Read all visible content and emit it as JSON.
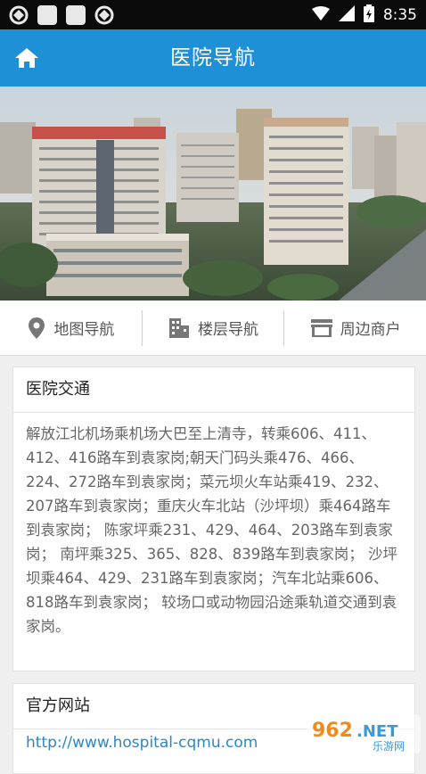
{
  "status_bar": {
    "time": "8:35"
  },
  "header": {
    "title": "医院导航"
  },
  "nav": {
    "items": [
      {
        "label": "地图导航",
        "icon": "map-pin-icon"
      },
      {
        "label": "楼层导航",
        "icon": "building-icon"
      },
      {
        "label": "周边商户",
        "icon": "storefront-icon"
      }
    ]
  },
  "traffic": {
    "title": "医院交通",
    "body": "解放江北机场乘机场大巴至上清寺，转乘606、411、412、416路车到袁家岗;朝天门码头乘476、466、224、272路车到袁家岗；菜元坝火车站乘419、232、207路车到袁家岗；重庆火车北站（沙坪坝）乘464路车到袁家岗； 陈家坪乘231、429、464、203路车到袁家岗； 南坪乘325、365、828、839路车到袁家岗； 沙坪坝乘464、429、231路车到袁家岗；汽车北站乘606、818路车到袁家岗； 较场口或动物园沿途乘轨道交通到袁家岗。"
  },
  "website": {
    "title": "官方网站",
    "url": "http://www.hospital-cqmu.com"
  },
  "watermark": {
    "brand": "962.NET",
    "sub": "乐游网"
  },
  "colors": {
    "appbar": "#1e90d6",
    "link": "#2a88c9"
  }
}
